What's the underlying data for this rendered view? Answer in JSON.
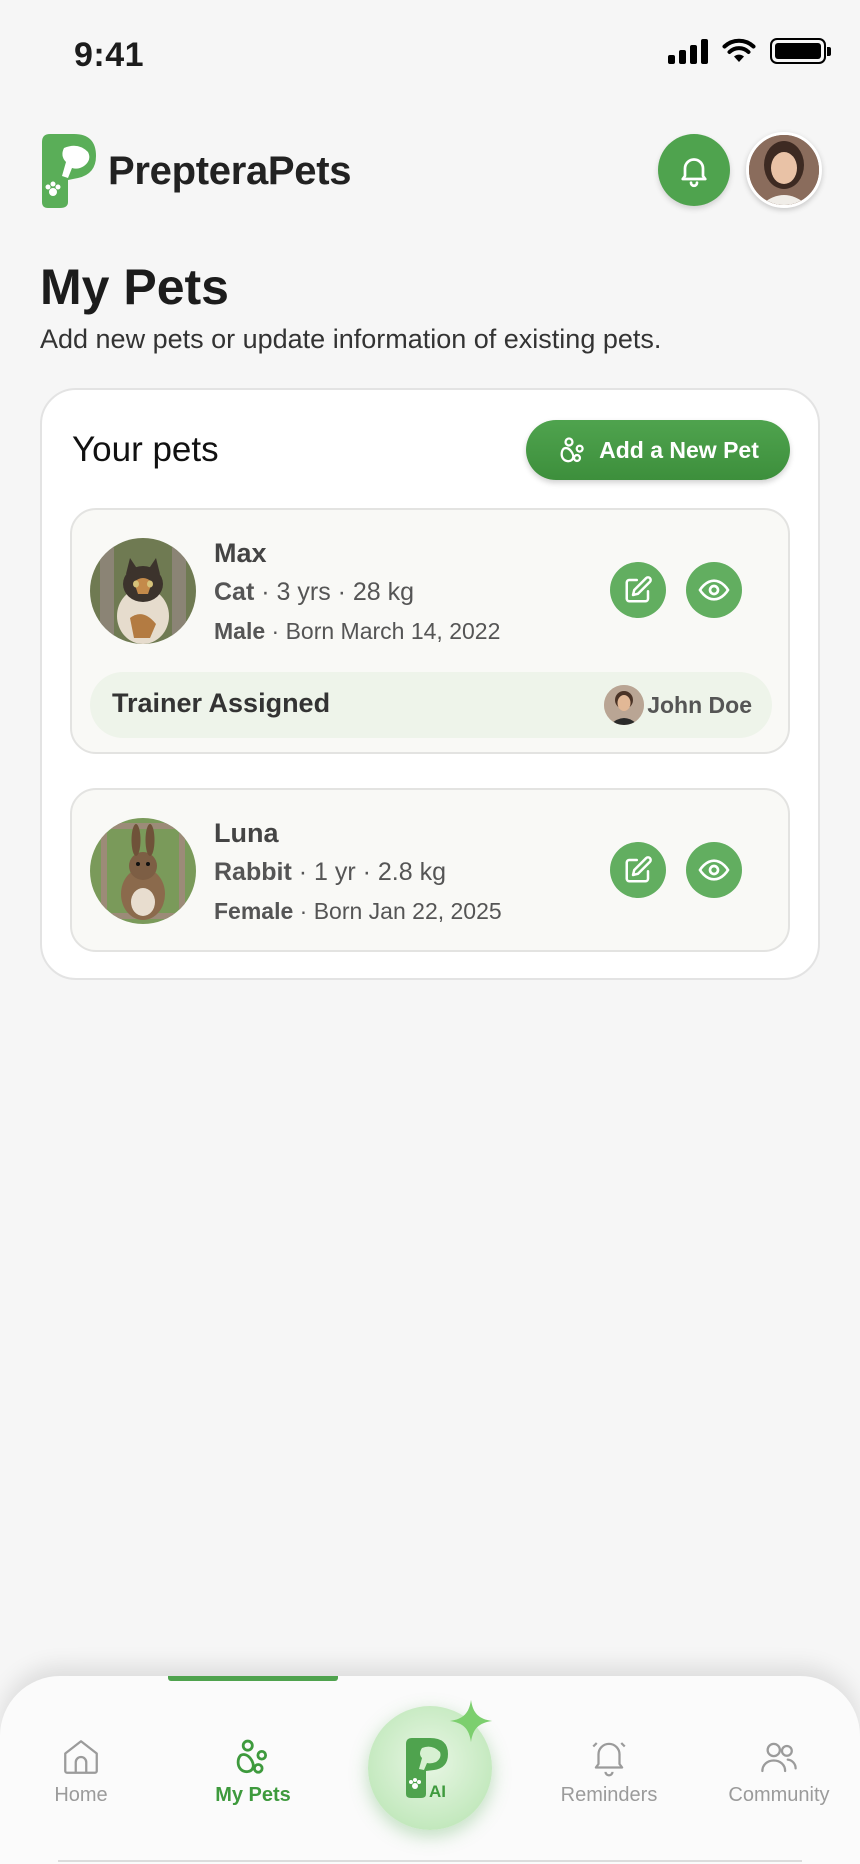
{
  "status_bar": {
    "time": "9:41"
  },
  "header": {
    "brand": "PrepteraPets"
  },
  "page": {
    "title": "My Pets",
    "subtitle": "Add new pets or update information of existing pets."
  },
  "pets_card": {
    "title": "Your pets",
    "add_button_label": "Add a New Pet",
    "pets": [
      {
        "name": "Max",
        "species": "Cat",
        "age_weight": " · 3 yrs · 28 kg",
        "sex": "Male",
        "born": " · Born March 14, 2022",
        "trainer_label": "Trainer Assigned",
        "trainer_name": "John Doe"
      },
      {
        "name": "Luna",
        "species": "Rabbit",
        "age_weight": " · 1 yr · 2.8 kg",
        "sex": "Female",
        "born": " · Born Jan 22, 2025"
      }
    ]
  },
  "nav": {
    "items": [
      {
        "label": "Home",
        "icon": "home-icon"
      },
      {
        "label": "My Pets",
        "icon": "paw-icon",
        "active": true
      },
      {
        "label": "AI",
        "icon": "ai-logo-icon"
      },
      {
        "label": "Reminders",
        "icon": "bell-icon"
      },
      {
        "label": "Community",
        "icon": "people-icon"
      }
    ]
  },
  "colors": {
    "primary": "#4fa34e",
    "primary_dark": "#3d8f3c",
    "background": "#f6f6f6",
    "trainer_bg": "#eef4ea"
  }
}
